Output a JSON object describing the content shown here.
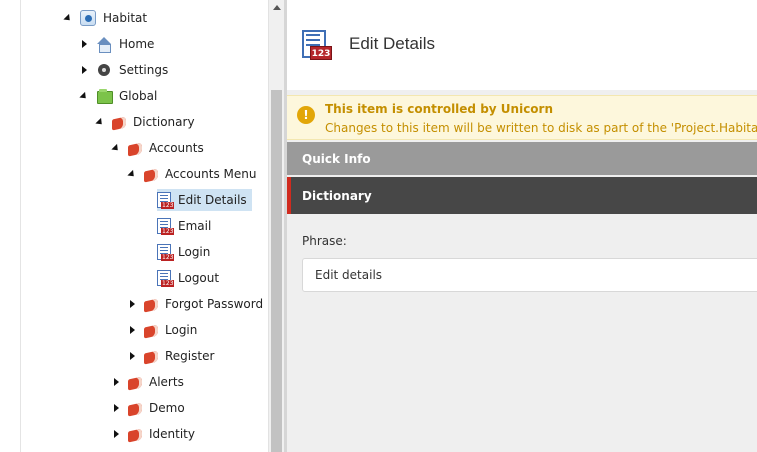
{
  "tree": {
    "items": [
      {
        "label": "Habitat",
        "icon": "globe-icon",
        "expanded": true
      },
      {
        "label": "Home",
        "icon": "home-icon",
        "expanded": false
      },
      {
        "label": "Settings",
        "icon": "gear-icon",
        "expanded": false
      },
      {
        "label": "Global",
        "icon": "folder-icon",
        "expanded": true
      },
      {
        "label": "Dictionary",
        "icon": "book-icon",
        "expanded": true
      },
      {
        "label": "Accounts",
        "icon": "book-icon",
        "expanded": true
      },
      {
        "label": "Accounts Menu",
        "icon": "book-icon",
        "expanded": true
      },
      {
        "label": "Edit Details",
        "icon": "dictionary-entry-icon",
        "selected": true
      },
      {
        "label": "Email",
        "icon": "dictionary-entry-icon"
      },
      {
        "label": "Login",
        "icon": "dictionary-entry-icon"
      },
      {
        "label": "Logout",
        "icon": "dictionary-entry-icon"
      },
      {
        "label": "Forgot Password",
        "icon": "book-icon",
        "expanded": false
      },
      {
        "label": "Login",
        "icon": "book-icon",
        "expanded": false
      },
      {
        "label": "Register",
        "icon": "book-icon",
        "expanded": false
      },
      {
        "label": "Alerts",
        "icon": "book-icon",
        "expanded": false
      },
      {
        "label": "Demo",
        "icon": "book-icon",
        "expanded": false
      },
      {
        "label": "Identity",
        "icon": "book-icon",
        "expanded": false
      }
    ]
  },
  "header": {
    "title": "Edit Details"
  },
  "warning": {
    "title": "This item is controlled by Unicorn",
    "text": "Changes to this item will be written to disk as part of the 'Project.Habitat.Website'",
    "color": "#c48f00"
  },
  "sections": {
    "quick_info": "Quick Info",
    "dictionary": "Dictionary"
  },
  "field": {
    "label": "Phrase:",
    "value": "Edit details"
  },
  "colors": {
    "selected": "#cfe3f3",
    "section_accent": "#d02b1f"
  }
}
